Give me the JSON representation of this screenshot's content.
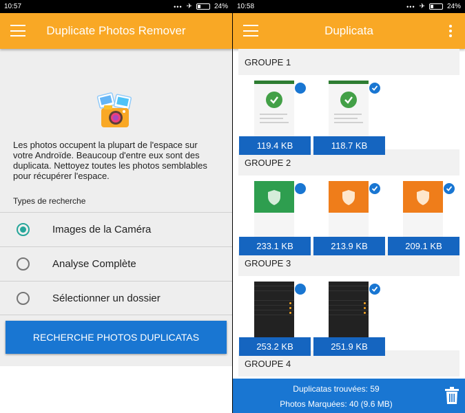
{
  "left": {
    "status": {
      "time": "10:57",
      "dots": "•••",
      "battery": "24%"
    },
    "appbar_title": "Duplicate Photos Remover",
    "description": "Les photos occupent la plupart de l'espace sur votre Androïde. Beaucoup d'entre eux sont des duplicata. Nettoyez toutes les photos semblables pour récupérer l'espace.",
    "types_label": "Types de recherche",
    "options": [
      {
        "label": "Images de la Caméra",
        "selected": true
      },
      {
        "label": "Analyse Complète",
        "selected": false
      },
      {
        "label": "Sélectionner un dossier",
        "selected": false
      }
    ],
    "search_button": "RECHERCHE PHOTOS DUPLICATAS"
  },
  "right": {
    "status": {
      "time": "10:58",
      "dots": "•••",
      "battery": "24%"
    },
    "appbar_title": "Duplicata",
    "groups": [
      {
        "label": "GROUPE 1",
        "items": [
          {
            "size": "119.4 KB",
            "marked": false
          },
          {
            "size": "118.7 KB",
            "marked": true
          }
        ]
      },
      {
        "label": "GROUPE 2",
        "items": [
          {
            "size": "233.1 KB",
            "marked": false
          },
          {
            "size": "213.9 KB",
            "marked": true
          },
          {
            "size": "209.1 KB",
            "marked": true
          }
        ]
      },
      {
        "label": "GROUPE 3",
        "items": [
          {
            "size": "253.2 KB",
            "marked": false
          },
          {
            "size": "251.9 KB",
            "marked": true
          }
        ]
      },
      {
        "label": "GROUPE 4",
        "items": []
      }
    ],
    "footer": {
      "found": "Duplicatas trouvées: 59",
      "marked": "Photos Marquées: 40 (9.6 MB)"
    }
  },
  "colors": {
    "appbar": "#f9a825",
    "primary": "#1976d2",
    "radio_selected": "#26a69a"
  },
  "icons": [
    "hamburger-icon",
    "kebab-menu-icon",
    "trash-icon",
    "checkmark-icon",
    "photos-camera-icon",
    "airplane-icon",
    "battery-icon"
  ]
}
